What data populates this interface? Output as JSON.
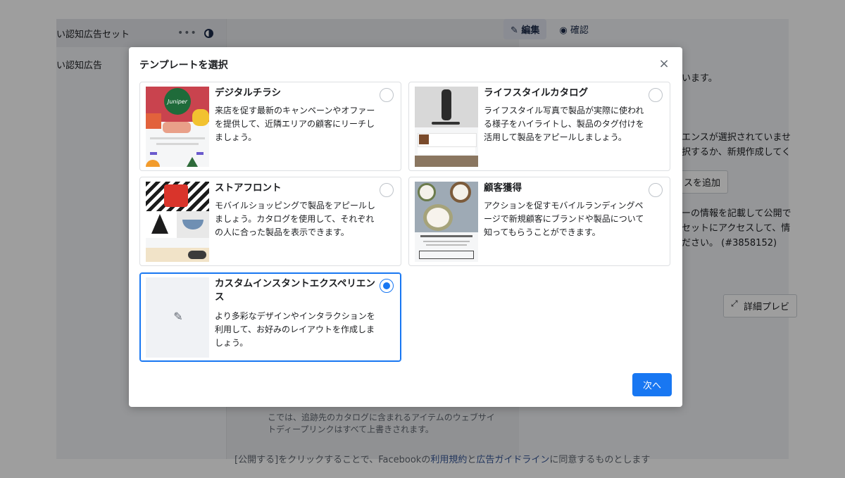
{
  "background": {
    "left_panel": {
      "row1_label": "い認知広告セット",
      "row1_more": "•••",
      "row2_label": "い認知広告"
    },
    "topbar": {
      "edit_label": "✎ 編集",
      "view_label": "◉ 確認"
    },
    "right_panel": {
      "notice1": "います。",
      "notice2_line1": "エンスが選択されていませ",
      "notice2_line2": "択するか、新規作成してく",
      "add_button": "スを追加",
      "info_line1": "ーの情報を記載して公開で",
      "info_line2": "セットにアクセスして、情",
      "info_line3": "ださい。 (#3858152)",
      "preview_button": "詳細プレビ"
    },
    "mid_bottom_line1": "こでは、追跡先のカタログに含まれるアイテムのウェブサイ",
    "mid_bottom_line2": "トディープリンクはすべて上書きされます。",
    "footer": {
      "text_before": "[公開する]をクリックすることで、Facebookの",
      "link1": "利用規約",
      "and": "と",
      "link2": "広告ガイドライン",
      "text_after": "に同意するものとします"
    }
  },
  "modal": {
    "title": "テンプレートを選択",
    "close_icon": "×",
    "next_button": "次へ",
    "templates": [
      {
        "title": "デジタルチラシ",
        "description": "来店を促す最新のキャンペーンやオファーを提供して、近隣エリアの顧客にリーチしましょう。",
        "selected": false,
        "thumb_logo": "Juniper"
      },
      {
        "title": "ライフスタイルカタログ",
        "description": "ライフスタイル写真で製品が実際に使われる様子をハイライトし、製品のタグ付けを活用して製品をアピールしましょう。",
        "selected": false
      },
      {
        "title": "ストアフロント",
        "description": "モバイルショッピングで製品をアピールしましょう。カタログを使用して、それぞれの人に合った製品を表示できます。",
        "selected": false
      },
      {
        "title": "顧客獲得",
        "description": "アクションを促すモバイルランディングページで新規顧客にブランドや製品について知ってもらうことができます。",
        "selected": false
      },
      {
        "title": "カスタムインスタントエクスペリエンス",
        "description": "より多彩なデザインやインタラクションを利用して、お好みのレイアウトを作成しましょう。",
        "selected": true,
        "icon": "edit-icon"
      }
    ]
  },
  "colors": {
    "accent": "#1877f2",
    "overlay": "rgba(0,0,0,0.38)"
  }
}
